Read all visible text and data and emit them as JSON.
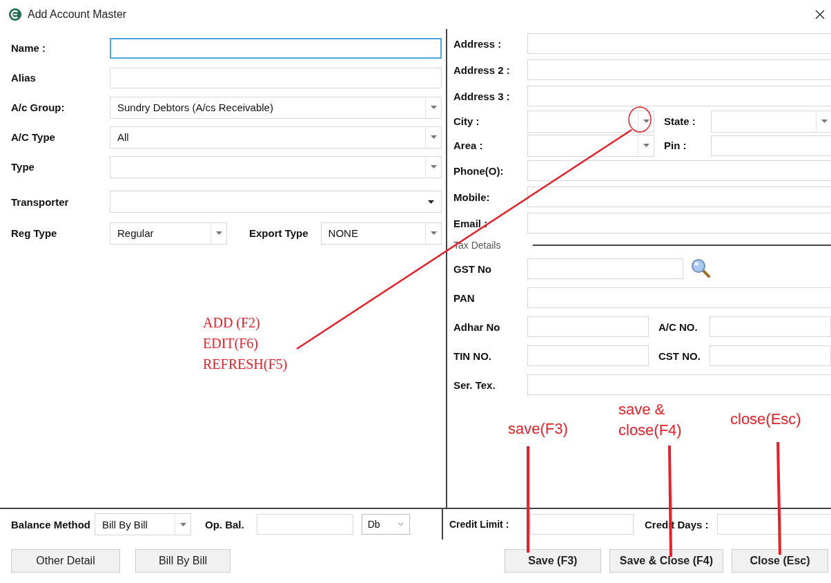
{
  "window": {
    "title": "Add Account Master"
  },
  "left_fields": [
    {
      "label": "Name :",
      "kind": "text",
      "focused": true
    },
    {
      "label": "Alias",
      "kind": "text",
      "focused": false
    },
    {
      "label": "A/c Group:",
      "kind": "combo",
      "value": "Sundry Debtors (A/cs Receivable)"
    },
    {
      "label": "A/C Type",
      "kind": "combo",
      "value": "All"
    },
    {
      "label": "Type",
      "kind": "combo"
    },
    {
      "label": "Transporter",
      "kind": "dropdown"
    }
  ],
  "reg_row": {
    "label": "Reg Type",
    "value": "Regular",
    "export_label": "Export Type",
    "export_value": "NONE"
  },
  "address_fields": [
    {
      "label": "Address :"
    },
    {
      "label": "Address 2 :"
    },
    {
      "label": "Address 3 :"
    }
  ],
  "city": {
    "label": "City :",
    "state_label": "State :"
  },
  "area": {
    "label": "Area :",
    "pin_label": "Pin :"
  },
  "contact_fields": [
    {
      "label": "Phone(O):"
    },
    {
      "label": "Mobile:"
    },
    {
      "label": "Email :"
    }
  ],
  "tax_details": {
    "heading": "Tax Details",
    "gst_label": "GST No",
    "pan_label": "PAN",
    "pairs": [
      {
        "label": "Adhar No",
        "label_2": "A/C NO."
      },
      {
        "label": "TIN NO.",
        "label_2": "CST NO."
      }
    ],
    "ser_label": "Ser. Tex."
  },
  "balance": {
    "label": "Balance Method",
    "value": "Bill By Bill",
    "op_label": "Op. Bal.",
    "dr_cr": "Db"
  },
  "credit": {
    "limit_label": "Credit Limit :",
    "days_label": "Credit Days :"
  },
  "left_buttons": [
    "Other Detail",
    "Bill By Bill"
  ],
  "buttons": [
    "Save (F3)",
    "Save & Close (F4)",
    "Close (Esc)"
  ],
  "annotations": {
    "note_lines": [
      "ADD (F2)",
      "EDIT(F6)",
      "REFRESH(F5)"
    ],
    "button_notes": [
      "save(F3)",
      "save & close(F4)",
      "close(Esc)"
    ]
  }
}
